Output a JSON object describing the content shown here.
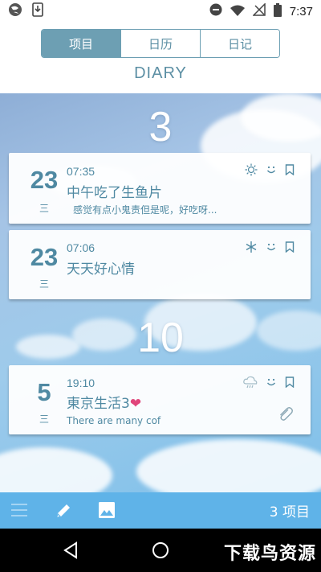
{
  "status": {
    "time": "7:37"
  },
  "tabs": [
    "项目",
    "日历",
    "日记"
  ],
  "title": "DIARY",
  "groups": [
    {
      "month": "3"
    },
    {
      "month": "10"
    }
  ],
  "entries": [
    {
      "day": "23",
      "weekday": "三",
      "time": "07:35",
      "title": "中午吃了生鱼片",
      "preview": "感觉有点小鬼责但是呢，好吃呀...",
      "weather": "sun-icon",
      "mood": "smile-icon"
    },
    {
      "day": "23",
      "weekday": "三",
      "time": "07:06",
      "title": "天天好心情",
      "preview": "",
      "weather": "snowflake-icon",
      "mood": "smile-icon"
    },
    {
      "day": "5",
      "weekday": "三",
      "time": "19:10",
      "title": "東京生活3",
      "title_emoji": "❤",
      "preview": "There are many cof",
      "weather": "cloud-rain-icon",
      "mood": "smile-icon",
      "has_attachment": true
    }
  ],
  "bottom": {
    "count_label": "3 项目"
  },
  "watermark": "下载鸟资源",
  "colors": {
    "accent": "#5c8fa4",
    "bottom_bar": "#5fb3e8",
    "heart": "#e0457a"
  }
}
